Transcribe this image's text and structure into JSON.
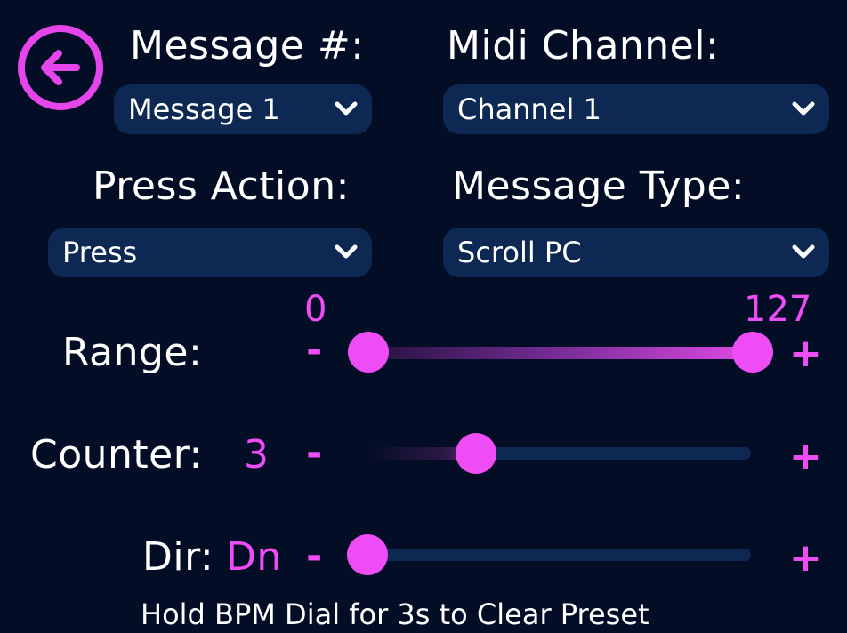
{
  "header": {
    "message_label": "Message #:",
    "midi_channel_label": "Midi Channel:"
  },
  "message_select": {
    "value": "Message 1"
  },
  "channel_select": {
    "value": "Channel 1"
  },
  "press_action": {
    "label": "Press Action:",
    "value": "Press"
  },
  "message_type": {
    "label": "Message Type:",
    "value": "Scroll PC"
  },
  "range": {
    "label": "Range:",
    "min_value": "0",
    "max_value": "127",
    "decrement": "-",
    "increment": "+"
  },
  "counter": {
    "label": "Counter:",
    "value": "3",
    "decrement": "-",
    "increment": "+"
  },
  "direction": {
    "label": "Dir:",
    "value": "Dn",
    "decrement": "-",
    "increment": "+"
  },
  "footer": {
    "hint": "Hold BPM Dial for 3s to Clear Preset"
  },
  "icons": {
    "back": "arrow-left-circle-icon",
    "dropdown": "chevron-down-icon"
  },
  "colors": {
    "background": "#040d26",
    "accent": "#ee4cf4",
    "control_bg": "#0c2853",
    "text": "#ffffff"
  }
}
